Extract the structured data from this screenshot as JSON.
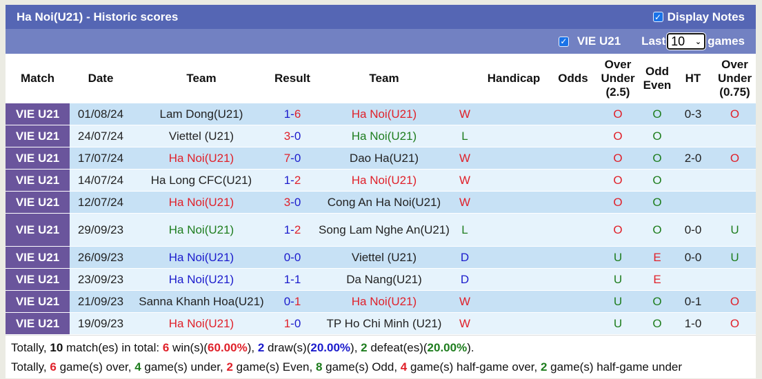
{
  "header": {
    "title": "Ha Noi(U21) - Historic scores",
    "display_notes_label": "Display Notes",
    "display_notes_checked": true
  },
  "filter": {
    "league_label": "VIE U21",
    "league_checked": true,
    "last_label": "Last",
    "games_count": "10",
    "games_label": "games"
  },
  "columns": {
    "match": "Match",
    "date": "Date",
    "team_home": "Team",
    "result": "Result",
    "team_away": "Team",
    "handicap": "Handicap",
    "odds": "Odds",
    "over_under_line1": "Over",
    "over_under_line2": "Under",
    "over_under_line3": "(2.5)",
    "odd_even_line1": "Odd",
    "odd_even_line2": "Even",
    "ht": "HT",
    "over_under2_line1": "Over",
    "over_under2_line2": "Under",
    "over_under2_line3": "(0.75)"
  },
  "colors": {
    "title_bar": "#5566b4",
    "filter_bar": "#7281c2",
    "match_cell": "#6a559c",
    "row_odd": "#c7e1f5",
    "row_even": "#e6f3fc",
    "win": "#e0212a",
    "draw": "#1b1bcc",
    "loss": "#1e7d1e"
  },
  "rows": [
    {
      "match": "VIE U21",
      "date": "01/08/24",
      "home": "Lam Dong(U21)",
      "home_color": "",
      "score_home": "1",
      "score_home_color": "blue",
      "score_away": "6",
      "score_away_color": "red",
      "away": "Ha Noi(U21)",
      "away_color": "red",
      "wl": "W",
      "wl_color": "red",
      "handicap": "",
      "odds": "",
      "ou": "O",
      "ou_color": "red",
      "oe": "O",
      "oe_color": "green",
      "ht": "0-3",
      "ou2": "O",
      "ou2_color": "red"
    },
    {
      "match": "VIE U21",
      "date": "24/07/24",
      "home": "Viettel (U21)",
      "home_color": "",
      "score_home": "3",
      "score_home_color": "red",
      "score_away": "0",
      "score_away_color": "blue",
      "away": "Ha Noi(U21)",
      "away_color": "green",
      "wl": "L",
      "wl_color": "green",
      "handicap": "",
      "odds": "",
      "ou": "O",
      "ou_color": "red",
      "oe": "O",
      "oe_color": "green",
      "ht": "",
      "ou2": "",
      "ou2_color": ""
    },
    {
      "match": "VIE U21",
      "date": "17/07/24",
      "home": "Ha Noi(U21)",
      "home_color": "red",
      "score_home": "7",
      "score_home_color": "red",
      "score_away": "0",
      "score_away_color": "blue",
      "away": "Dao Ha(U21)",
      "away_color": "",
      "wl": "W",
      "wl_color": "red",
      "handicap": "",
      "odds": "",
      "ou": "O",
      "ou_color": "red",
      "oe": "O",
      "oe_color": "green",
      "ht": "2-0",
      "ou2": "O",
      "ou2_color": "red"
    },
    {
      "match": "VIE U21",
      "date": "14/07/24",
      "home": "Ha Long CFC(U21)",
      "home_color": "",
      "score_home": "1",
      "score_home_color": "blue",
      "score_away": "2",
      "score_away_color": "red",
      "away": "Ha Noi(U21)",
      "away_color": "red",
      "wl": "W",
      "wl_color": "red",
      "handicap": "",
      "odds": "",
      "ou": "O",
      "ou_color": "red",
      "oe": "O",
      "oe_color": "green",
      "ht": "",
      "ou2": "",
      "ou2_color": ""
    },
    {
      "match": "VIE U21",
      "date": "12/07/24",
      "home": "Ha Noi(U21)",
      "home_color": "red",
      "score_home": "3",
      "score_home_color": "red",
      "score_away": "0",
      "score_away_color": "blue",
      "away": "Cong An Ha Noi(U21)",
      "away_color": "",
      "wl": "W",
      "wl_color": "red",
      "handicap": "",
      "odds": "",
      "ou": "O",
      "ou_color": "red",
      "oe": "O",
      "oe_color": "green",
      "ht": "",
      "ou2": "",
      "ou2_color": ""
    },
    {
      "match": "VIE U21",
      "date": "29/09/23",
      "home": "Ha Noi(U21)",
      "home_color": "green",
      "score_home": "1",
      "score_home_color": "blue",
      "score_away": "2",
      "score_away_color": "red",
      "away": "Song Lam Nghe An(U21)",
      "away_color": "",
      "wl": "L",
      "wl_color": "green",
      "handicap": "",
      "odds": "",
      "ou": "O",
      "ou_color": "red",
      "oe": "O",
      "oe_color": "green",
      "ht": "0-0",
      "ou2": "U",
      "ou2_color": "green",
      "tall": true
    },
    {
      "match": "VIE U21",
      "date": "26/09/23",
      "home": "Ha Noi(U21)",
      "home_color": "blue",
      "score_home": "0",
      "score_home_color": "blue",
      "score_away": "0",
      "score_away_color": "blue",
      "away": "Viettel (U21)",
      "away_color": "",
      "wl": "D",
      "wl_color": "blue",
      "handicap": "",
      "odds": "",
      "ou": "U",
      "ou_color": "green",
      "oe": "E",
      "oe_color": "red",
      "ht": "0-0",
      "ou2": "U",
      "ou2_color": "green"
    },
    {
      "match": "VIE U21",
      "date": "23/09/23",
      "home": "Ha Noi(U21)",
      "home_color": "blue",
      "score_home": "1",
      "score_home_color": "blue",
      "score_away": "1",
      "score_away_color": "blue",
      "away": "Da Nang(U21)",
      "away_color": "",
      "wl": "D",
      "wl_color": "blue",
      "handicap": "",
      "odds": "",
      "ou": "U",
      "ou_color": "green",
      "oe": "E",
      "oe_color": "red",
      "ht": "",
      "ou2": "",
      "ou2_color": ""
    },
    {
      "match": "VIE U21",
      "date": "21/09/23",
      "home": "Sanna Khanh Hoa(U21)",
      "home_color": "",
      "score_home": "0",
      "score_home_color": "blue",
      "score_away": "1",
      "score_away_color": "red",
      "away": "Ha Noi(U21)",
      "away_color": "red",
      "wl": "W",
      "wl_color": "red",
      "handicap": "",
      "odds": "",
      "ou": "U",
      "ou_color": "green",
      "oe": "O",
      "oe_color": "green",
      "ht": "0-1",
      "ou2": "O",
      "ou2_color": "red"
    },
    {
      "match": "VIE U21",
      "date": "19/09/23",
      "home": "Ha Noi(U21)",
      "home_color": "red",
      "score_home": "1",
      "score_home_color": "red",
      "score_away": "0",
      "score_away_color": "blue",
      "away": "TP Ho Chi Minh (U21)",
      "away_color": "",
      "wl": "W",
      "wl_color": "red",
      "handicap": "",
      "odds": "",
      "ou": "U",
      "ou_color": "green",
      "oe": "O",
      "oe_color": "green",
      "ht": "1-0",
      "ou2": "O",
      "ou2_color": "red"
    }
  ],
  "summary": {
    "line1": {
      "prefix": "Totally, ",
      "total": "10",
      "t1": " match(es) in total: ",
      "wins": "6",
      "t2": " win(s)(",
      "win_pct": "60.00%",
      "t3": "), ",
      "draws": "2",
      "t4": " draw(s)(",
      "draw_pct": "20.00%",
      "t5": "), ",
      "defeats": "2",
      "t6": " defeat(es)(",
      "defeat_pct": "20.00%",
      "t7": ")."
    },
    "line2": {
      "prefix": "Totally, ",
      "over": "6",
      "t1": " game(s) over, ",
      "under": "4",
      "t2": " game(s) under, ",
      "even": "2",
      "t3": " game(s) Even, ",
      "odd": "8",
      "t4": " game(s) Odd, ",
      "half_over": "4",
      "t5": " game(s) half-game over, ",
      "half_under": "2",
      "t6": " game(s) half-game under"
    }
  }
}
